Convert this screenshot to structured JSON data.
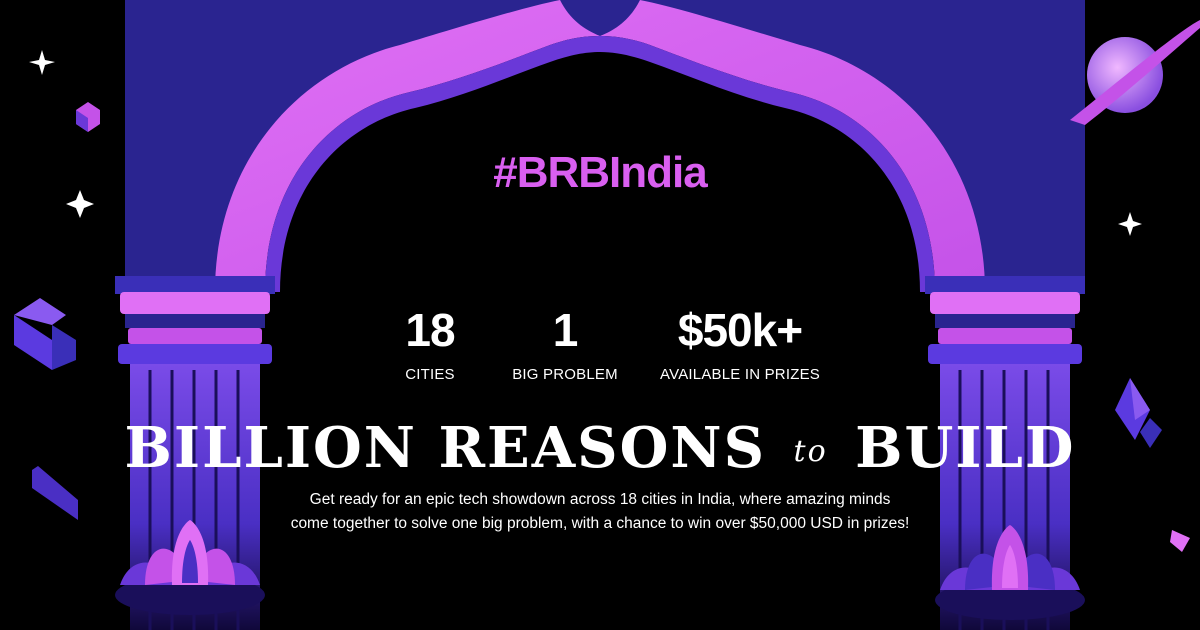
{
  "hashtag": "#BRBIndia",
  "stats": [
    {
      "value": "18",
      "label": "CITIES"
    },
    {
      "value": "1",
      "label": "BIG PROBLEM"
    },
    {
      "value": "$50k+",
      "label": "AVAILABLE IN PRIZES"
    }
  ],
  "headline": {
    "part1": "BILLION REASONS",
    "connector": "to",
    "part2": "BUILD"
  },
  "description": "Get ready for an epic tech showdown across 18 cities in India, where amazing minds come together to solve one big problem, with a chance to win over $50,000 USD in prizes!",
  "colors": {
    "background": "#000000",
    "arch_pink": "#d95ff0",
    "arch_blue": "#2a2490",
    "accent": "#d95ff0"
  },
  "icons": [
    "sparkle-icon",
    "cube-icon",
    "planet-icon",
    "lotus-icon",
    "crystal-icon",
    "pillar-icon"
  ]
}
